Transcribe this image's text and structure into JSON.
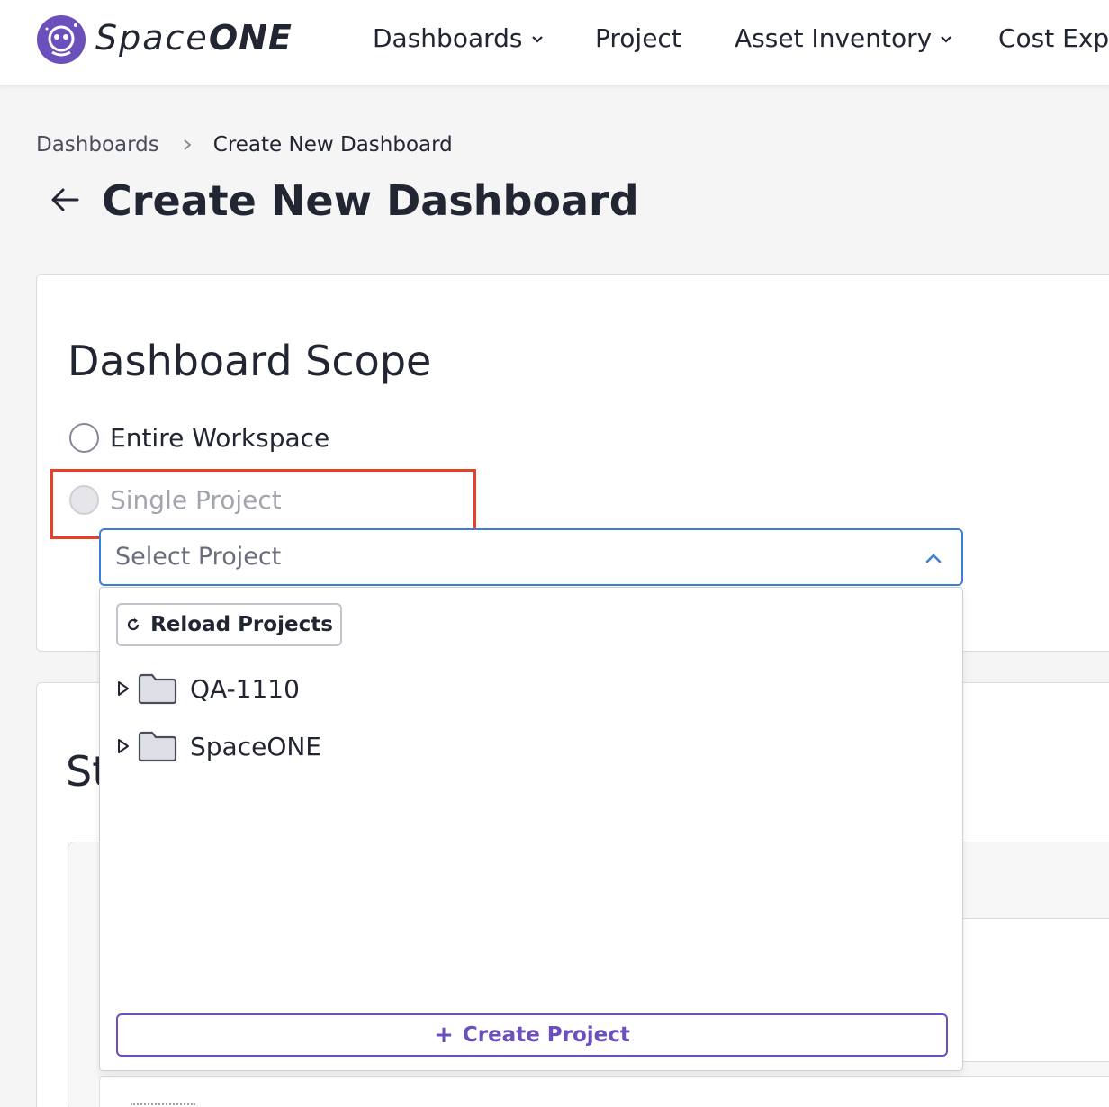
{
  "nav": {
    "logo_text_thin": "Space",
    "logo_text_bold": "ONE",
    "items": [
      {
        "label": "Dashboards",
        "has_chevron": true
      },
      {
        "label": "Project",
        "has_chevron": false
      },
      {
        "label": "Asset Inventory",
        "has_chevron": true
      },
      {
        "label": "Cost Explo",
        "has_chevron": false
      }
    ]
  },
  "breadcrumb": {
    "parent": "Dashboards",
    "current": "Create New Dashboard"
  },
  "page": {
    "title": "Create New Dashboard"
  },
  "scope": {
    "title": "Dashboard Scope",
    "options": [
      {
        "label": "Entire Workspace",
        "selected": false,
        "disabled": false
      },
      {
        "label": "Single Project",
        "selected": false,
        "disabled": true
      }
    ],
    "select": {
      "placeholder": "Select Project",
      "expanded": true
    }
  },
  "dropdown": {
    "reload_label": "Reload Projects",
    "tree": [
      {
        "label": "QA-1110",
        "type": "folder",
        "expandable": true
      },
      {
        "label": "SpaceONE",
        "type": "folder",
        "expandable": true
      }
    ],
    "create_label": "Create Project"
  },
  "second_section": {
    "title": "St"
  },
  "colors": {
    "brand": "#6b4fbb",
    "focus": "#3d7fd8",
    "highlight": "#e5402a",
    "text": "#222532",
    "background": "#f5f5f6"
  }
}
